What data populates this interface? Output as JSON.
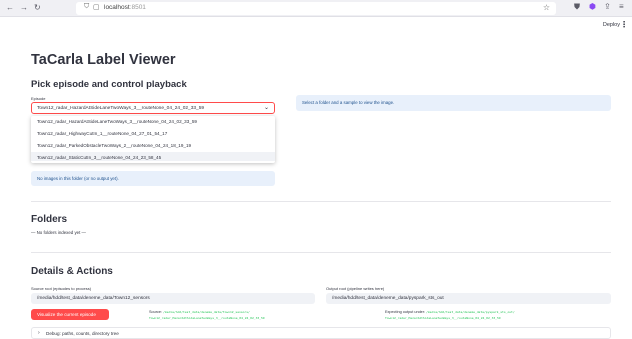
{
  "browser": {
    "url_host": "localhost",
    "url_port": ":8501"
  },
  "header": {
    "deploy_label": "Deploy"
  },
  "page": {
    "title": "TaCarla Label Viewer",
    "section_pick": "Pick episode and control playback",
    "episode_label": "Episode",
    "episode_selected": "Town12_radar_HazardAtSideLaneTwoWays_3__routeNone_04_24_02_33_59",
    "episode_options": [
      "Town12_radar_HazardAtSideLaneTwoWays_3__routeNone_04_24_02_33_59",
      "Town12_radar_HighwayCutIn_1__routeNone_04_27_01_54_17",
      "Town12_radar_ParkedObstacleTwoWays_2__routeNone_04_24_18_19_19",
      "Town12_radar_StaticCutIn_3__routeNone_04_24_23_58_45"
    ],
    "right_info": "Select a folder and a sample to view the image.",
    "no_images_info": "No images in this folder (or no output yet).",
    "folders_title": "Folders",
    "folders_empty": "— No folders indexed yet —",
    "details_title": "Details & Actions",
    "source_label": "Source root (episodes to process)",
    "source_value": "/media/hdd/test_data/deneme_data/Town12_sensors",
    "output_label": "Output root (pipeline writes here)",
    "output_value": "/media/hdd/test_data/deneme_data/pyspark_sts_out",
    "visualize_button": "Visualize the current episode",
    "source_kv_label": "Source:",
    "source_kv_line1": "/media/hdd/test_data/deneme_data/Town12_sensors/",
    "source_kv_line2": "Town12_radar_HazardAtSideLaneTwoWays_3__routeNone_04_24_02_33_59",
    "expected_kv_label": "Expecting output under:",
    "expected_kv_line1": "/media/hdd/test_data/deneme_data/pyspark_sts_out/",
    "expected_kv_line2": "Town12_radar_HazardAtSideLaneTwoWays_3__routeNone_04_24_02_33_59",
    "debug_expander": "Debug: paths, counts, directory tree"
  },
  "colors": {
    "primary": "#ff4b4b",
    "info_bg": "#e8f0fb",
    "info_text": "#1c4f8c",
    "code_green": "#21c354"
  }
}
